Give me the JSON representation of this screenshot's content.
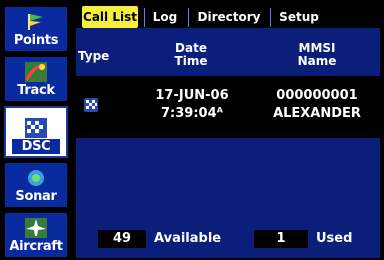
{
  "sidebar": {
    "items": [
      {
        "label": "Points",
        "icon": "flag-icon"
      },
      {
        "label": "Track",
        "icon": "track-icon"
      },
      {
        "label": "DSC",
        "icon": "checkered-flag-icon",
        "active": true
      },
      {
        "label": "Sonar",
        "icon": "sonar-icon"
      },
      {
        "label": "Aircraft",
        "icon": "airplane-icon"
      }
    ]
  },
  "tabs": [
    {
      "label": "Call List",
      "active": true
    },
    {
      "label": "Log"
    },
    {
      "label": "Directory"
    },
    {
      "label": "Setup"
    }
  ],
  "table": {
    "headers": {
      "type": "Type",
      "date_line1": "Date",
      "date_line2": "Time",
      "mmsi_line1": "MMSI",
      "mmsi_line2": "Name"
    },
    "rows": [
      {
        "type_icon": "checkered-flag-icon",
        "date": "17-JUN-06",
        "time": "7:39:04ᴬ",
        "mmsi": "000000001",
        "name": "ALEXANDER"
      }
    ]
  },
  "footer": {
    "available_count": "49",
    "available_label": "Available",
    "used_count": "1",
    "used_label": "Used"
  },
  "colors": {
    "panel": "#0b1f7a",
    "sidebar": "#0a2ba0",
    "active_tab": "#f5ee3c"
  }
}
